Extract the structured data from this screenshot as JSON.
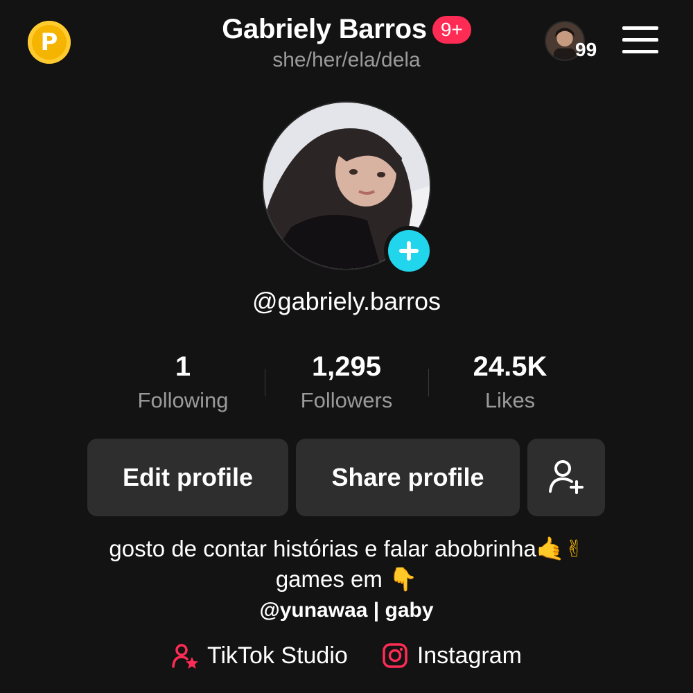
{
  "header": {
    "points_glyph": "P",
    "display_name": "Gabriely Barros",
    "notification_badge": "9+",
    "pronouns": "she/her/ela/dela",
    "story_count": "99",
    "accent_color": "#fe2c55"
  },
  "profile": {
    "username": "@gabriely.barros",
    "add_color": "#20d5ec"
  },
  "stats": [
    {
      "value": "1",
      "label": "Following"
    },
    {
      "value": "1,295",
      "label": "Followers"
    },
    {
      "value": "24.5K",
      "label": "Likes"
    }
  ],
  "actions": {
    "edit_profile": "Edit profile",
    "share_profile": "Share profile",
    "add_friend_icon": "add-user-icon"
  },
  "bio": {
    "line1": "gosto de contar histórias e falar abobrinha",
    "line1_emoji": "🤙✌",
    "line2": "games em",
    "line2_emoji": "👇",
    "handle_line": "@yunawaa | gaby"
  },
  "links": {
    "studio": "TikTok Studio",
    "instagram": "Instagram"
  }
}
